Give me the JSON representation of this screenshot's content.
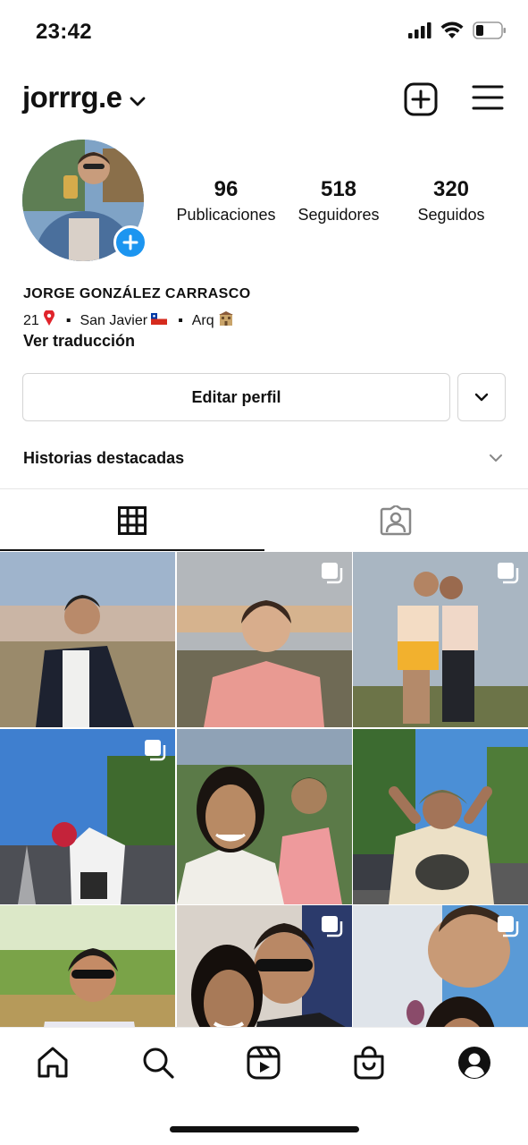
{
  "status_bar": {
    "time": "23:42",
    "icons": [
      "cellular-signal-icon",
      "wifi-icon",
      "battery-icon"
    ]
  },
  "header": {
    "username": "jorrrg.e",
    "icons": [
      "chevron-down-icon",
      "new-post-icon",
      "menu-icon"
    ]
  },
  "profile": {
    "stats": [
      {
        "value": "96",
        "label": "Publicaciones"
      },
      {
        "value": "518",
        "label": "Seguidores"
      },
      {
        "value": "320",
        "label": "Seguidos"
      }
    ],
    "full_name": "JORGE GONZÁLEZ CARRASCO",
    "bio": {
      "age": "21",
      "separator": "▪",
      "location": "San Javier",
      "occupation": "Arq"
    },
    "translate_label": "Ver traducción"
  },
  "actions": {
    "edit_profile": "Editar perfil"
  },
  "highlights": {
    "title": "Historias destacadas"
  },
  "tabs": [
    {
      "name": "grid-tab",
      "icon": "grid-icon",
      "active": true
    },
    {
      "name": "tagged-tab",
      "icon": "tagged-icon",
      "active": false
    }
  ],
  "posts": [
    {
      "multi": false
    },
    {
      "multi": true
    },
    {
      "multi": true
    },
    {
      "multi": true
    },
    {
      "multi": false
    },
    {
      "multi": false
    },
    {
      "multi": false
    },
    {
      "multi": true
    },
    {
      "multi": true
    }
  ],
  "bottom_nav": [
    "home-icon",
    "search-icon",
    "reels-icon",
    "shop-icon",
    "profile-icon"
  ],
  "colors": {
    "accent_blue": "#1c95f0",
    "border": "#d4d4d4",
    "text": "#111111"
  }
}
